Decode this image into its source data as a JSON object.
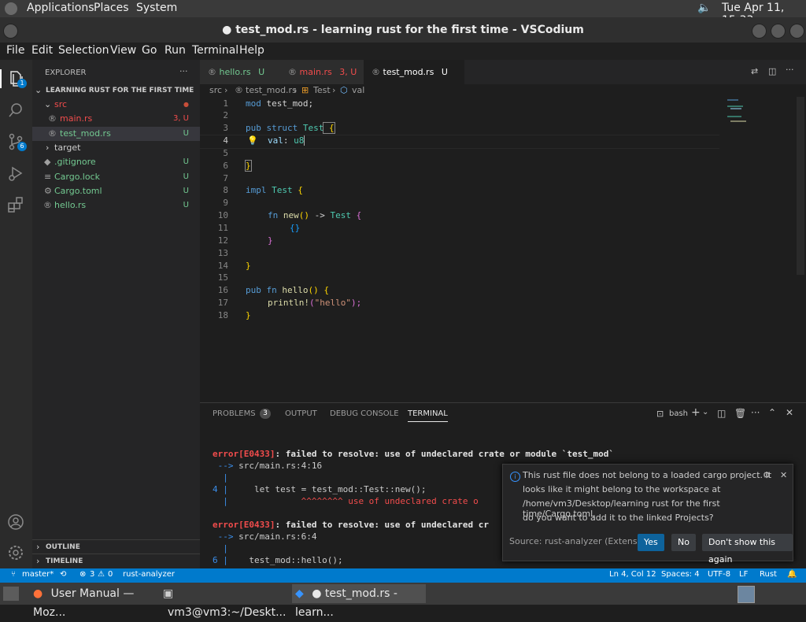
{
  "system_bar": {
    "menus": [
      "Applications",
      "Places",
      "System"
    ],
    "clock": "Tue Apr 11, 15:33"
  },
  "window": {
    "title": "● test_mod.rs - learning rust for the first time - VSCodium"
  },
  "menubar": [
    "File",
    "Edit",
    "Selection",
    "View",
    "Go",
    "Run",
    "Terminal",
    "Help"
  ],
  "activity": {
    "explorer_badge": "1",
    "scm_badge": "6"
  },
  "sidebar": {
    "header": "EXPLORER",
    "more": "···",
    "project": "LEARNING RUST FOR THE FIRST TIME",
    "src_folder": "src",
    "items": [
      {
        "name": "main.rs",
        "status": "3, U"
      },
      {
        "name": "test_mod.rs",
        "status": "U"
      },
      {
        "name": "target",
        "status": ""
      },
      {
        "name": ".gitignore",
        "status": "U"
      },
      {
        "name": "Cargo.lock",
        "status": "U"
      },
      {
        "name": "Cargo.toml",
        "status": "U"
      },
      {
        "name": "hello.rs",
        "status": "U"
      }
    ],
    "outline": "OUTLINE",
    "timeline": "TIMELINE"
  },
  "tabs": [
    {
      "label": "hello.rs",
      "status": "U"
    },
    {
      "label": "main.rs",
      "status": "3, U"
    },
    {
      "label": "test_mod.rs",
      "status": "U",
      "dirty": "●"
    }
  ],
  "breadcrumb": [
    "src",
    "test_mod.rs",
    "Test",
    "val"
  ],
  "code": {
    "line_numbers": [
      "1",
      "2",
      "3",
      "4",
      "5",
      "6",
      "7",
      "8",
      "9",
      "10",
      "11",
      "12",
      "13",
      "14",
      "15",
      "16",
      "17",
      "18"
    ],
    "ln1_kw": "mod",
    "ln1_rest": " test_mod;",
    "ln3_kw": "pub struct",
    "ln3_ty": " Test",
    "ln3_br": " {",
    "ln4_field": "val",
    "ln4_sep": ": ",
    "ln4_ty": "u8",
    "ln6_br": "}",
    "ln8_kw": "impl",
    "ln8_ty": " Test",
    "ln8_br": " {",
    "ln10_kw": "fn",
    "ln10_fn": " new",
    "ln10_p": "()",
    "ln10_arrow": " -> ",
    "ln10_ty": "Test",
    "ln10_br": " {",
    "ln11_br": "{}",
    "ln12_br": "}",
    "ln14_br": "}",
    "ln16_kw": "pub fn",
    "ln16_fn": " hello",
    "ln16_p": "()",
    "ln16_br": " {",
    "ln17_fn": "println!",
    "ln17_p1": "(",
    "ln17_str": "\"hello\"",
    "ln17_p2": ");",
    "ln18_br": "}"
  },
  "panel": {
    "tabs": [
      "PROBLEMS",
      "OUTPUT",
      "DEBUG CONSOLE",
      "TERMINAL"
    ],
    "problems_count": "3",
    "shell": "bash"
  },
  "terminal": {
    "e1_code": "error[E0433]",
    "e1_msg": ": failed to resolve: use of undeclared crate or module `test_mod`",
    "e1_loc_arrow": " --> ",
    "e1_loc": "src/main.rs:4:16",
    "pipe": "  |",
    "e1_lnum": "4",
    "e1_line": "     let test = test_mod::Test::new();",
    "e1_carets": "^^^^^^^^ use of undeclared crate o",
    "e2_code": "error[E0433]",
    "e2_msg": ": failed to resolve: use of undeclared cr",
    "e2_loc_arrow": " --> ",
    "e2_loc": "src/main.rs:6:4",
    "e2_lnum": "6",
    "e2_line": "    test_mod::hello();"
  },
  "notification": {
    "line1": "This rust file does not belong to a loaded cargo project. It",
    "line2": "looks like it might belong to the workspace at",
    "line3": "/home/vm3/Desktop/learning rust for the first time/Cargo.toml,",
    "line4": "do you want to add it to the linked Projects?",
    "source": "Source: rust-analyzer (Extension)",
    "yes": "Yes",
    "no": "No",
    "dont_show": "Don't show this again"
  },
  "status": {
    "branch": "master*",
    "errors": "3",
    "warnings": "0",
    "analyzer": "rust-analyzer",
    "position": "Ln 4, Col 12",
    "spaces": "Spaces: 4",
    "encoding": "UTF-8",
    "eol": "LF",
    "language": "Rust"
  },
  "taskbar": {
    "tasks": [
      "User Manual — Moz...",
      "vm3@vm3:~/Deskt...",
      "● test_mod.rs - learn..."
    ]
  },
  "colors": {
    "accent": "#007acc",
    "error": "#f14c4c",
    "untracked": "#73c991"
  }
}
